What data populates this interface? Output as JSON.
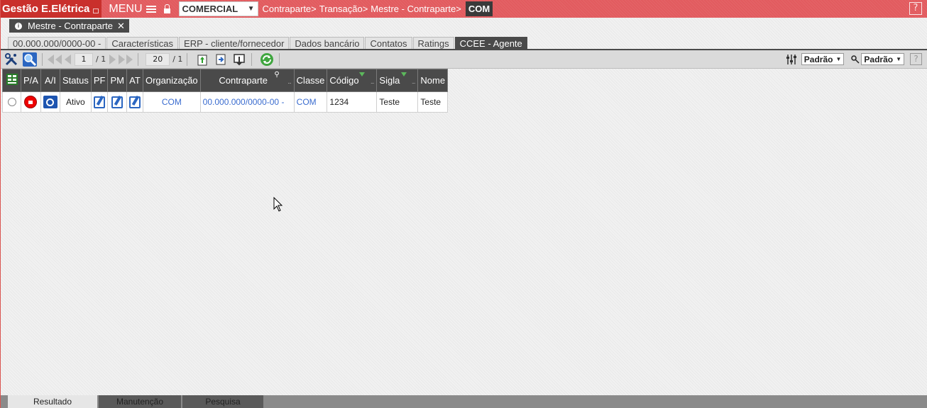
{
  "topbar": {
    "app_title": "Gestão E.Elétrica",
    "menu_label": "MENU",
    "org_select_value": "COMERCIAL",
    "breadcrumb": [
      "Contraparte>",
      "Transação>",
      "Mestre - Contraparte>"
    ],
    "breadcrumb_current": "COM",
    "help": "?"
  },
  "window_tab": {
    "label": "Mestre - Contraparte",
    "info": "i",
    "close": "✕"
  },
  "tabs": [
    {
      "label": "00.000.000/0000-00 -"
    },
    {
      "label": "Características"
    },
    {
      "label": "ERP - cliente/fornecedor"
    },
    {
      "label": "Dados bancário"
    },
    {
      "label": "Contatos"
    },
    {
      "label": "Ratings"
    },
    {
      "label": "CCEE - Agente",
      "active": true
    }
  ],
  "toolbar": {
    "page_current": "1",
    "page_total": "/ 1",
    "page_size": "20",
    "page_size_total": "/ 1",
    "select1": "Padrão",
    "select2": "Padrão",
    "help": "?"
  },
  "grid": {
    "headers": [
      "P/A",
      "A/I",
      "Status",
      "PF",
      "PM",
      "AT",
      "Organização",
      "Contraparte",
      "Classe",
      "Código",
      "Sigla",
      "Nome"
    ],
    "rows": [
      {
        "status": "Ativo",
        "organizacao": "COM",
        "contraparte": "00.000.000/0000-00 -",
        "classe": "COM",
        "codigo": "1234",
        "sigla": "Teste",
        "nome": "Teste"
      }
    ]
  },
  "bottom_tabs": [
    {
      "label": "Resultado",
      "active": true
    },
    {
      "label": "Manutenção"
    },
    {
      "label": "Pesquisa"
    }
  ],
  "colors": {
    "topbar": "#e25b5f",
    "title_bg": "#c9302c",
    "dark": "#4a4a4a",
    "link": "#3a6ccf"
  }
}
